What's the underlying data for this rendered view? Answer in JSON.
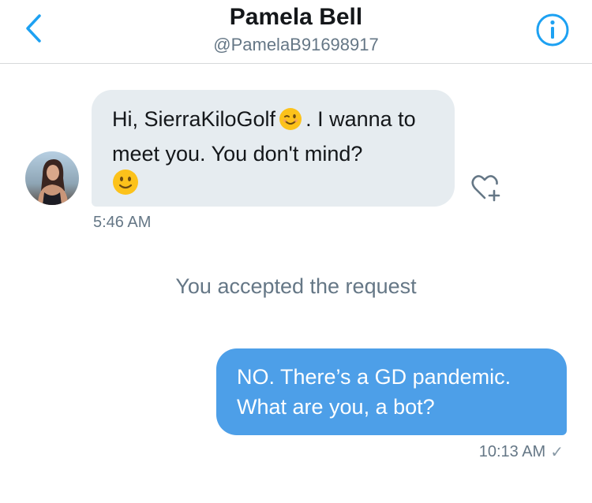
{
  "header": {
    "title": "Pamela Bell",
    "handle": "@PamelaB91698917",
    "back_icon": "chevron-left-icon",
    "info_icon": "info-icon"
  },
  "colors": {
    "accent": "#1da1f2",
    "outgoing_bubble": "#4d9fe8",
    "incoming_bubble": "#e6ecf0",
    "secondary_text": "#657786"
  },
  "messages": [
    {
      "direction": "incoming",
      "text_part1": "Hi, SierraKiloGolf",
      "emoji1": "winking-face-emoji",
      "text_part2": ". I wanna to meet you. You don't mind?",
      "emoji2": "slightly-smiling-face-emoji",
      "time": "5:46 AM",
      "reaction_icon": "heart-add-icon"
    },
    {
      "direction": "outgoing",
      "text": "NO. There’s a GD pandemic. What are you, a bot?",
      "time": "10:13 AM",
      "status": "✓"
    }
  ],
  "system_message": "You accepted the request"
}
